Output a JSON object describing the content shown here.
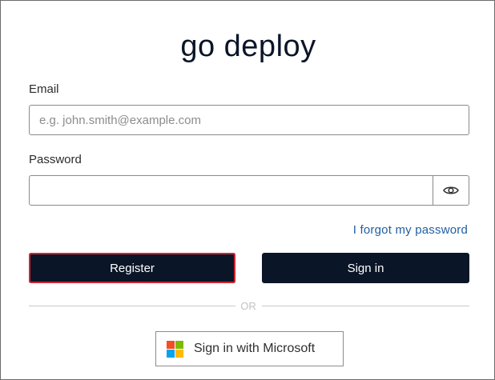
{
  "app": {
    "title": "go deploy"
  },
  "form": {
    "email": {
      "label": "Email",
      "placeholder": "e.g. john.smith@example.com",
      "value": ""
    },
    "password": {
      "label": "Password",
      "value": "",
      "toggle_icon": "eye-icon"
    },
    "forgot_link": "I forgot my password",
    "register_label": "Register",
    "signin_label": "Sign in",
    "divider_text": "OR",
    "microsoft_label": "Sign in with Microsoft"
  },
  "colors": {
    "primary": "#0b1528",
    "focus_outline": "#d22630",
    "link": "#1f5fa3",
    "ms_red": "#f25022",
    "ms_green": "#7fba00",
    "ms_blue": "#00a4ef",
    "ms_yellow": "#ffb900"
  }
}
